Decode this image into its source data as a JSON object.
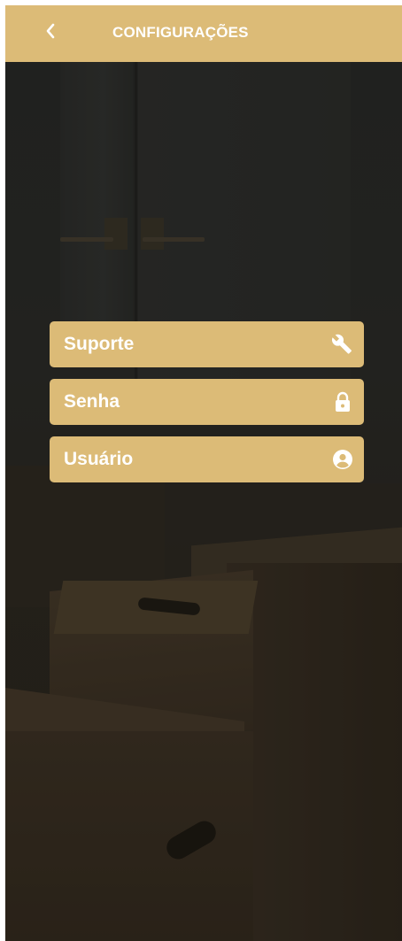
{
  "header": {
    "title": "CONFIGURAÇÕES",
    "back_icon": "chevron-left-icon"
  },
  "menu": {
    "items": [
      {
        "label": "Suporte",
        "icon": "wrench-icon"
      },
      {
        "label": "Senha",
        "icon": "lock-icon"
      },
      {
        "label": "Usuário",
        "icon": "account-circle-icon"
      }
    ]
  },
  "colors": {
    "accent": "#dcbb77",
    "text_on_accent": "#ffffff"
  }
}
